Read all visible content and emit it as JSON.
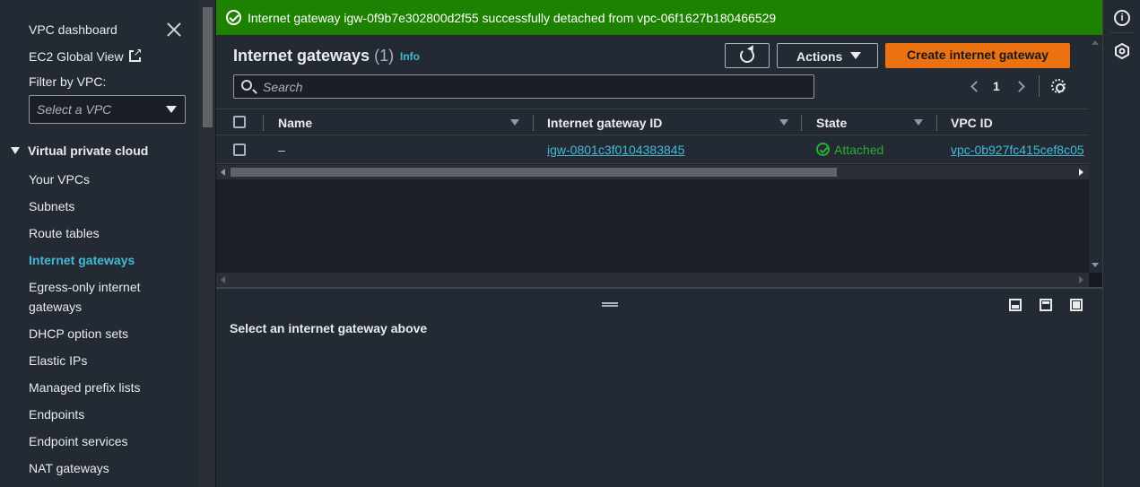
{
  "sidebar": {
    "dashboard_link": "VPC dashboard",
    "global_view_link": "EC2 Global View",
    "filter_label": "Filter by VPC:",
    "filter_placeholder": "Select a VPC",
    "section_title": "Virtual private cloud",
    "items": [
      {
        "label": "Your VPCs",
        "active": false
      },
      {
        "label": "Subnets",
        "active": false
      },
      {
        "label": "Route tables",
        "active": false
      },
      {
        "label": "Internet gateways",
        "active": true
      },
      {
        "label": "Egress-only internet gateways",
        "active": false
      },
      {
        "label": "DHCP option sets",
        "active": false
      },
      {
        "label": "Elastic IPs",
        "active": false
      },
      {
        "label": "Managed prefix lists",
        "active": false
      },
      {
        "label": "Endpoints",
        "active": false
      },
      {
        "label": "Endpoint services",
        "active": false
      },
      {
        "label": "NAT gateways",
        "active": false
      }
    ]
  },
  "flash": {
    "message": "Internet gateway igw-0f9b7e302800d2f55 successfully detached from vpc-06f1627b180466529",
    "color": "#1d8102"
  },
  "panel": {
    "title": "Internet gateways",
    "count": "(1)",
    "info": "Info",
    "actions_label": "Actions",
    "create_label": "Create internet gateway",
    "search_placeholder": "Search",
    "page": "1"
  },
  "table": {
    "columns": [
      "Name",
      "Internet gateway ID",
      "State",
      "VPC ID"
    ],
    "rows": [
      {
        "name": "–",
        "gateway_id": "igw-0801c3f0104383845",
        "state": "Attached",
        "vpc_id": "vpc-0b927fc415cef8c05"
      }
    ]
  },
  "split": {
    "message": "Select an internet gateway above"
  },
  "colors": {
    "accent_link": "#44b9d6",
    "primary_button": "#ec7211",
    "success": "#29ad32"
  },
  "icons": [
    "close-icon",
    "external-link-icon",
    "chevron-down-icon",
    "refresh-icon",
    "search-icon",
    "settings-icon",
    "info-icon",
    "hexagon-icon",
    "check-circle-icon"
  ]
}
